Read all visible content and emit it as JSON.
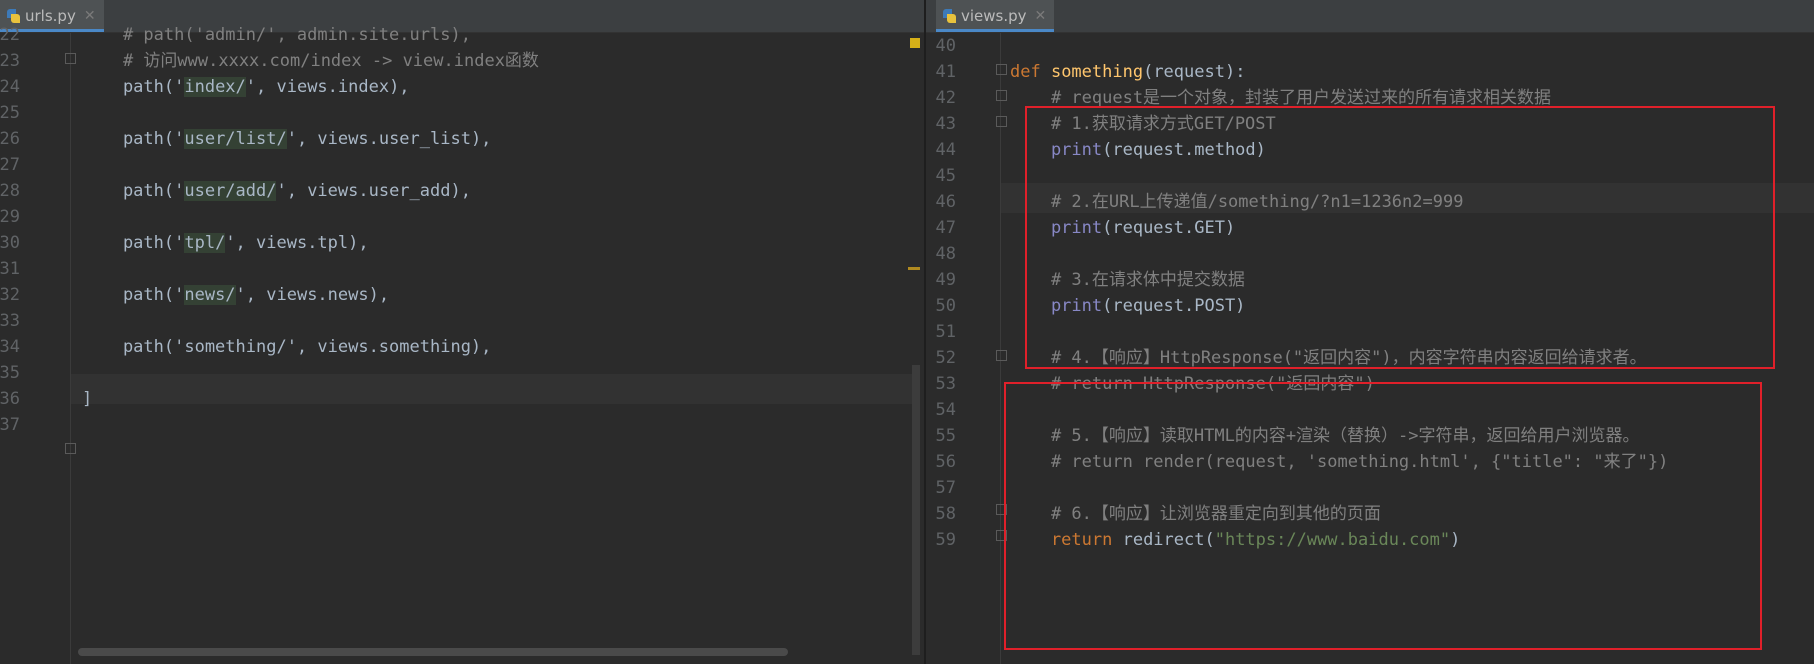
{
  "left_pane": {
    "tab": {
      "label": "urls.py",
      "icon": "python-file-icon"
    },
    "lines": [
      {
        "n": "22",
        "segments": [
          [
            "cm",
            "    # path('admin/', admin.site.urls),"
          ]
        ]
      },
      {
        "n": "23",
        "segments": [
          [
            "cm",
            "    # 访问www.xxxx.com/index -> view.index函数"
          ]
        ]
      },
      {
        "n": "24",
        "segments": [
          [
            "st",
            "    path('"
          ],
          [
            "hl",
            "index/"
          ],
          [
            "st",
            "', views.index),"
          ]
        ]
      },
      {
        "n": "25",
        "segments": []
      },
      {
        "n": "26",
        "segments": [
          [
            "st",
            "    path('"
          ],
          [
            "hl",
            "user/list/"
          ],
          [
            "st",
            "', views.user_list),"
          ]
        ]
      },
      {
        "n": "27",
        "segments": []
      },
      {
        "n": "28",
        "segments": [
          [
            "st",
            "    path('"
          ],
          [
            "hl",
            "user/add/"
          ],
          [
            "st",
            "', views.user_add),"
          ]
        ]
      },
      {
        "n": "29",
        "segments": []
      },
      {
        "n": "30",
        "segments": [
          [
            "st",
            "    path('"
          ],
          [
            "hl",
            "tpl/"
          ],
          [
            "st",
            "', views.tpl),"
          ]
        ]
      },
      {
        "n": "31",
        "segments": []
      },
      {
        "n": "32",
        "segments": [
          [
            "st",
            "    path('"
          ],
          [
            "hl",
            "news/"
          ],
          [
            "st",
            "', views.news),"
          ]
        ]
      },
      {
        "n": "33",
        "segments": []
      },
      {
        "n": "34",
        "segments": [
          [
            "st",
            "    path('something/', views.something),"
          ]
        ]
      },
      {
        "n": "35",
        "segments": []
      },
      {
        "n": "36",
        "segments": [
          [
            "st",
            "]"
          ]
        ]
      },
      {
        "n": "37",
        "segments": []
      }
    ]
  },
  "right_pane": {
    "tab": {
      "label": "views.py",
      "icon": "python-file-icon"
    },
    "lines": [
      {
        "n": "40",
        "segments": []
      },
      {
        "n": "41",
        "segments": [
          [
            "kw",
            "def "
          ],
          [
            "fn",
            "something"
          ],
          [
            "st",
            "(request):"
          ]
        ]
      },
      {
        "n": "42",
        "segments": [
          [
            "cm",
            "    # request是一个对象，封装了用户发送过来的所有请求相关数据"
          ]
        ]
      },
      {
        "n": "43",
        "segments": [
          [
            "cm",
            "    # 1.获取请求方式GET/POST"
          ]
        ]
      },
      {
        "n": "44",
        "segments": [
          [
            "bi",
            "    print"
          ],
          [
            "st",
            "(request.method)"
          ]
        ]
      },
      {
        "n": "45",
        "segments": []
      },
      {
        "n": "46",
        "segments": [
          [
            "cm",
            "    # 2.在URL上传递值/something/?n1=1236n2=999"
          ]
        ]
      },
      {
        "n": "47",
        "segments": [
          [
            "bi",
            "    print"
          ],
          [
            "st",
            "(request.GET)"
          ]
        ]
      },
      {
        "n": "48",
        "segments": []
      },
      {
        "n": "49",
        "segments": [
          [
            "cm",
            "    # 3.在请求体中提交数据"
          ]
        ]
      },
      {
        "n": "50",
        "segments": [
          [
            "bi",
            "    print"
          ],
          [
            "st",
            "(request.POST)"
          ]
        ]
      },
      {
        "n": "51",
        "segments": []
      },
      {
        "n": "52",
        "segments": [
          [
            "cm",
            "    # 4.【响应】HttpResponse(\"返回内容\")，内容字符串内容返回给请求者。"
          ]
        ]
      },
      {
        "n": "53",
        "segments": [
          [
            "cm",
            "    # return HttpResponse(\"返回内容\")"
          ]
        ]
      },
      {
        "n": "54",
        "segments": []
      },
      {
        "n": "55",
        "segments": [
          [
            "cm",
            "    # 5.【响应】读取HTML的内容+渲染（替换）->字符串，返回给用户浏览器。"
          ]
        ]
      },
      {
        "n": "56",
        "segments": [
          [
            "cm",
            "    # return render(request, 'something.html', {\"title\": \"来了\"})"
          ]
        ]
      },
      {
        "n": "57",
        "segments": []
      },
      {
        "n": "58",
        "segments": [
          [
            "cm",
            "    # 6.【响应】让浏览器重定向到其他的页面"
          ]
        ]
      },
      {
        "n": "59",
        "segments": [
          [
            "kw",
            "    return "
          ],
          [
            "st",
            "redirect("
          ],
          [
            "str",
            "\"https://www.baidu.com\""
          ],
          [
            "st",
            ")"
          ]
        ]
      }
    ]
  },
  "colors": {
    "background": "#2b2b2b",
    "comment": "#808080",
    "keyword": "#cc7832",
    "function": "#ffc66d",
    "builtin": "#8888c6",
    "string": "#6a8759",
    "annotation_box": "#e0202a"
  }
}
